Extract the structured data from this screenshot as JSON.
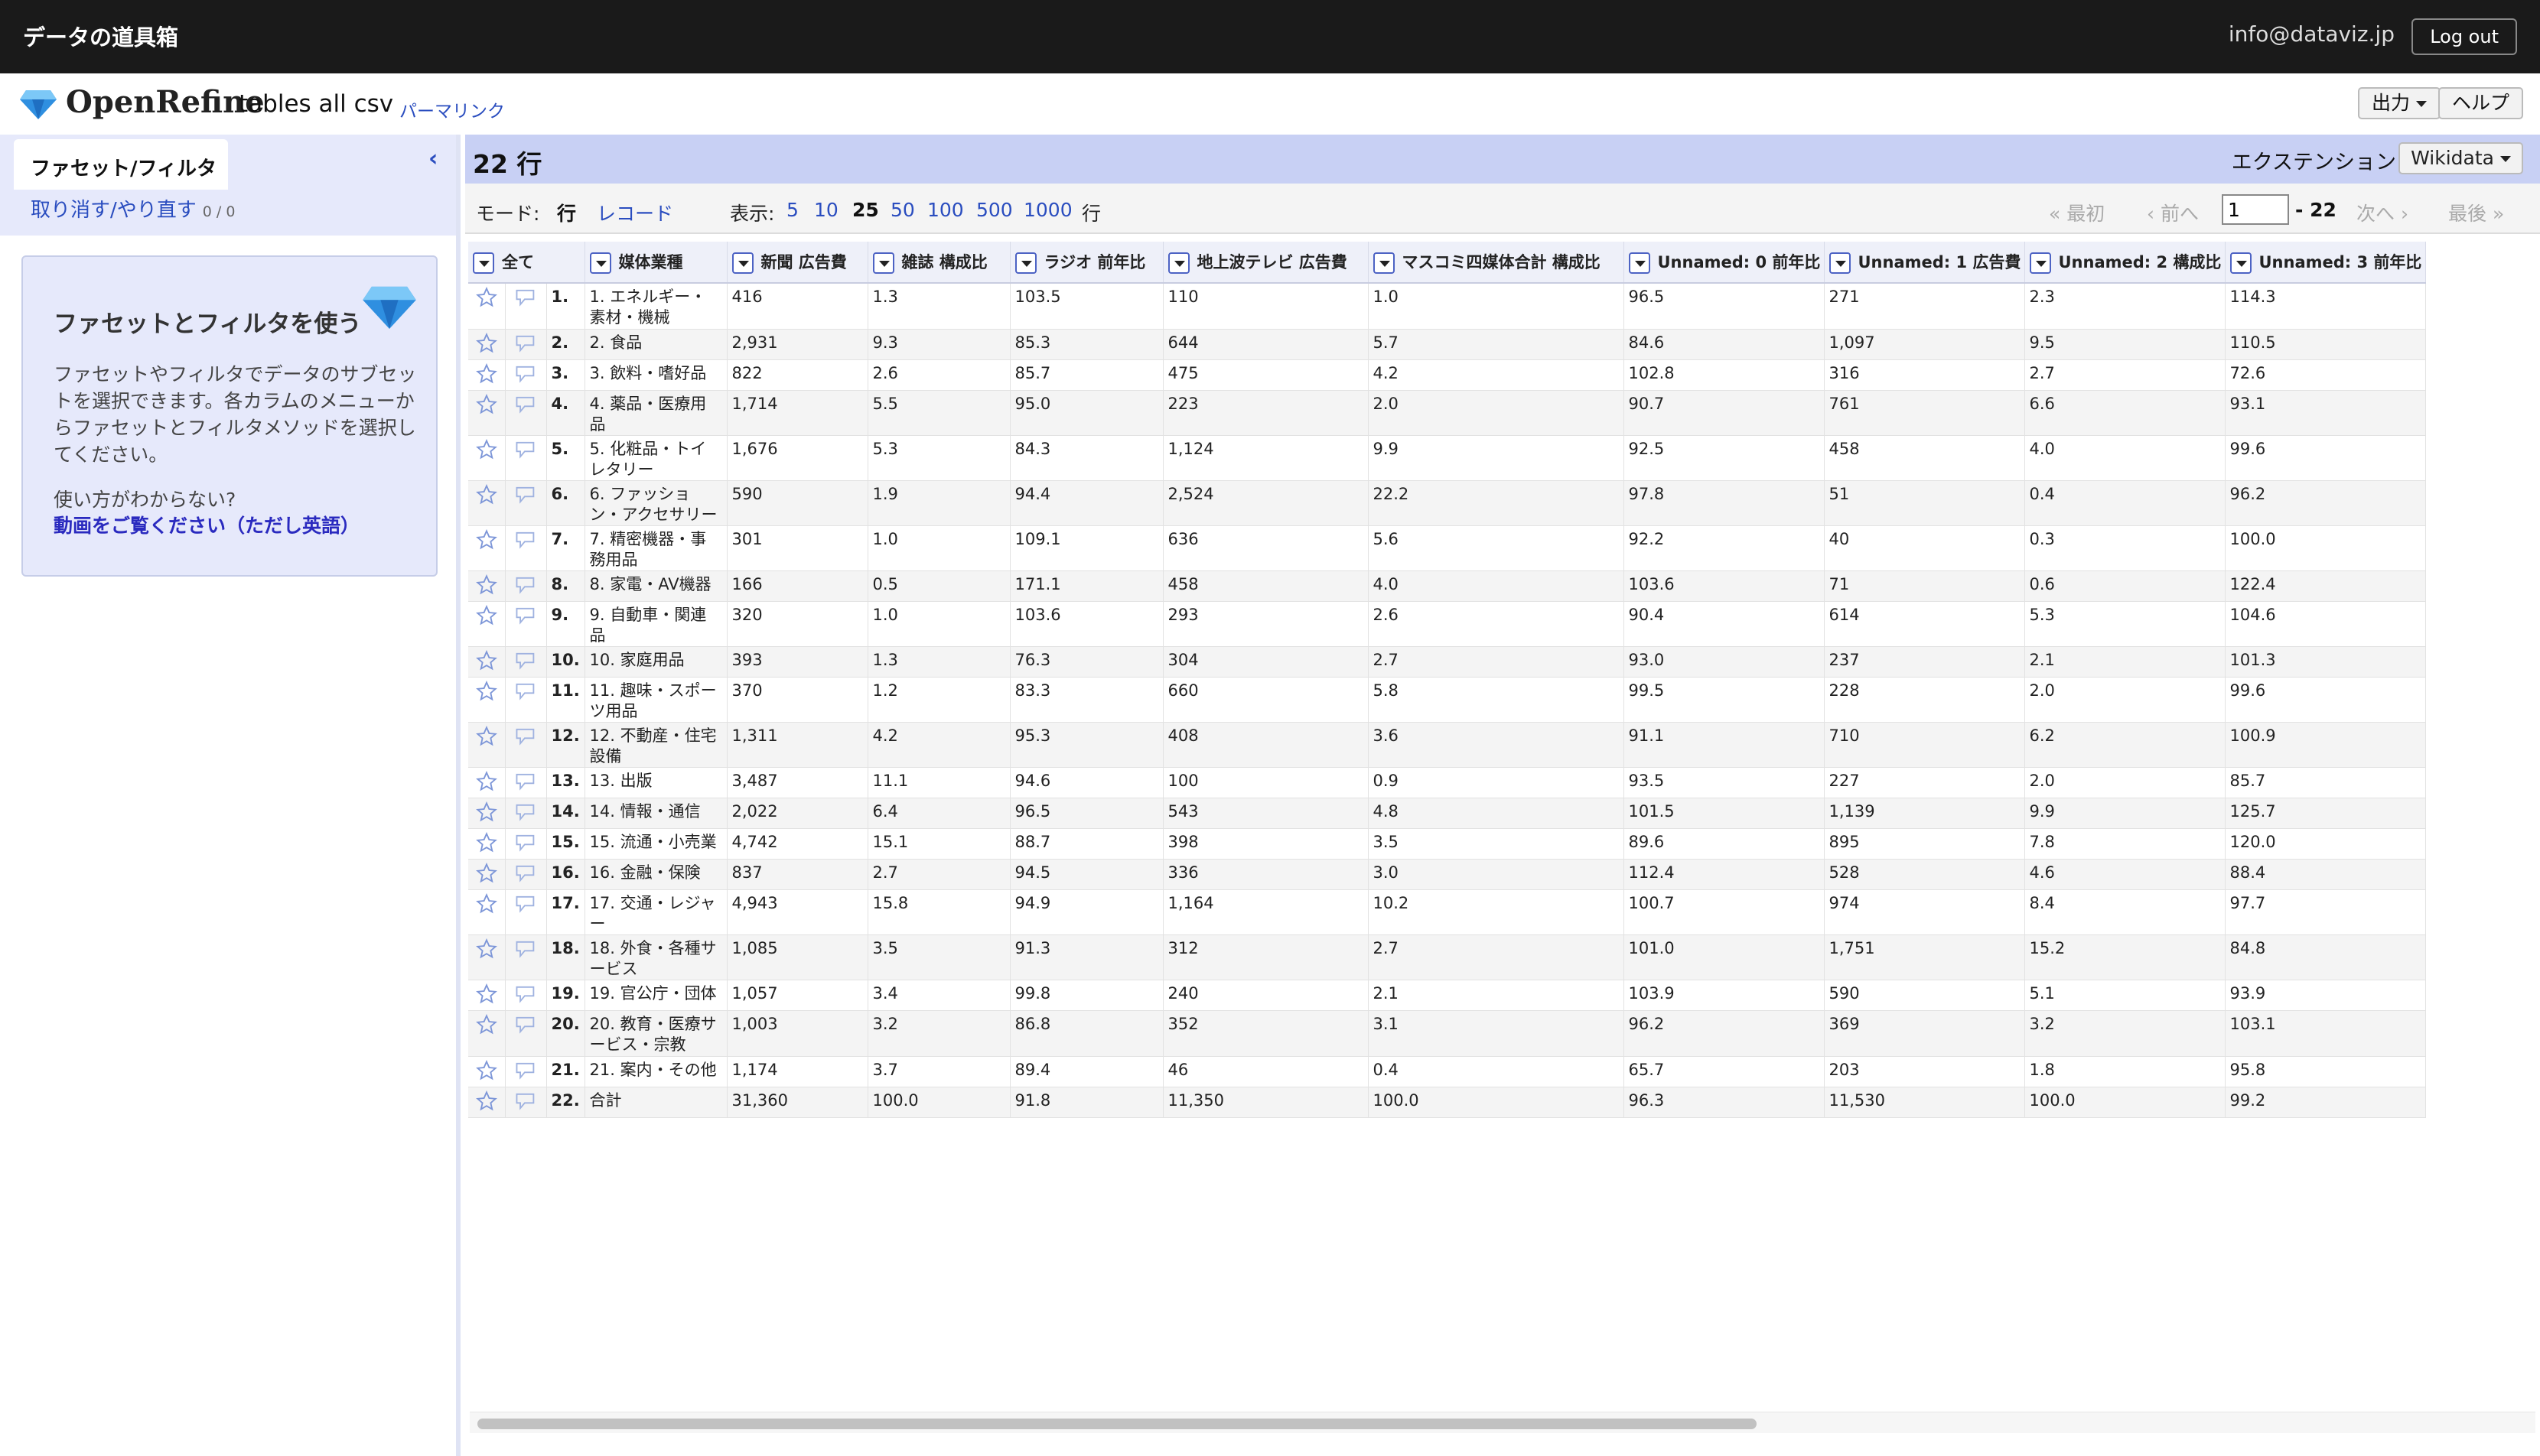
{
  "topbar": {
    "site_title": "データの道具箱",
    "email": "info@dataviz.jp",
    "logout": "Log out"
  },
  "header": {
    "logo": "OpenRefine",
    "project_name": "tables all csv",
    "permalink": "パーマリンク",
    "export": "出力",
    "help": "ヘルプ"
  },
  "left": {
    "tab": "ファセット/フィルタ",
    "undo": "取り消す/やり直す",
    "undo_count": "0 / 0",
    "box_title": "ファセットとフィルタを使う",
    "box_desc": "ファセットやフィルタでデータのサブセットを選択できます。各カラムのメニューからファセットとフィルタメソッドを選択してください。",
    "box_question": "使い方がわからない?",
    "box_video": "動画をご覧ください（ただし英語）"
  },
  "summary": {
    "rows": "22 行",
    "extensions": "エクステンション",
    "wikidata": "Wikidata"
  },
  "controls": {
    "mode_label": "モード:",
    "mode_rows": "行",
    "mode_records": "レコード",
    "show_label": "表示:",
    "sizes": [
      "5",
      "10",
      "25",
      "50",
      "100",
      "500",
      "1000"
    ],
    "selected_size": "25",
    "rows_unit": "行",
    "first": "« 最初",
    "prev": "‹ 前へ",
    "page": "1",
    "total": "- 22",
    "next": "次へ ›",
    "last": "最後 »"
  },
  "colors": {
    "accent": "#2a4dbf",
    "summary_bg": "#c8d0f4",
    "topbar": "#1a1a1a"
  },
  "table": {
    "all_label": "全て",
    "columns": [
      "媒体業種",
      "新聞 広告費",
      "雑誌 構成比",
      "ラジオ 前年比",
      "地上波テレビ 広告費",
      "マスコミ四媒体合計 構成比",
      "Unnamed: 0 前年比",
      "Unnamed: 1 広告費",
      "Unnamed: 2 構成比",
      "Unnamed: 3 前年比"
    ],
    "rows": [
      [
        "1.",
        "1. エネルギー・素材・機械",
        "416",
        "1.3",
        "103.5",
        "110",
        "1.0",
        "96.5",
        "271",
        "2.3",
        "114.3"
      ],
      [
        "2.",
        "2. 食品",
        "2,931",
        "9.3",
        "85.3",
        "644",
        "5.7",
        "84.6",
        "1,097",
        "9.5",
        "110.5"
      ],
      [
        "3.",
        "3. 飲料・嗜好品",
        "822",
        "2.6",
        "85.7",
        "475",
        "4.2",
        "102.8",
        "316",
        "2.7",
        "72.6"
      ],
      [
        "4.",
        "4. 薬品・医療用品",
        "1,714",
        "5.5",
        "95.0",
        "223",
        "2.0",
        "90.7",
        "761",
        "6.6",
        "93.1"
      ],
      [
        "5.",
        "5. 化粧品・トイレタリー",
        "1,676",
        "5.3",
        "84.3",
        "1,124",
        "9.9",
        "92.5",
        "458",
        "4.0",
        "99.6"
      ],
      [
        "6.",
        "6. ファッション・アクセサリー",
        "590",
        "1.9",
        "94.4",
        "2,524",
        "22.2",
        "97.8",
        "51",
        "0.4",
        "96.2"
      ],
      [
        "7.",
        "7. 精密機器・事務用品",
        "301",
        "1.0",
        "109.1",
        "636",
        "5.6",
        "92.2",
        "40",
        "0.3",
        "100.0"
      ],
      [
        "8.",
        "8. 家電・AV機器",
        "166",
        "0.5",
        "171.1",
        "458",
        "4.0",
        "103.6",
        "71",
        "0.6",
        "122.4"
      ],
      [
        "9.",
        "9. 自動車・関連品",
        "320",
        "1.0",
        "103.6",
        "293",
        "2.6",
        "90.4",
        "614",
        "5.3",
        "104.6"
      ],
      [
        "10.",
        "10. 家庭用品",
        "393",
        "1.3",
        "76.3",
        "304",
        "2.7",
        "93.0",
        "237",
        "2.1",
        "101.3"
      ],
      [
        "11.",
        "11. 趣味・スポーツ用品",
        "370",
        "1.2",
        "83.3",
        "660",
        "5.8",
        "99.5",
        "228",
        "2.0",
        "99.6"
      ],
      [
        "12.",
        "12. 不動産・住宅設備",
        "1,311",
        "4.2",
        "95.3",
        "408",
        "3.6",
        "91.1",
        "710",
        "6.2",
        "100.9"
      ],
      [
        "13.",
        "13. 出版",
        "3,487",
        "11.1",
        "94.6",
        "100",
        "0.9",
        "93.5",
        "227",
        "2.0",
        "85.7"
      ],
      [
        "14.",
        "14. 情報・通信",
        "2,022",
        "6.4",
        "96.5",
        "543",
        "4.8",
        "101.5",
        "1,139",
        "9.9",
        "125.7"
      ],
      [
        "15.",
        "15. 流通・小売業",
        "4,742",
        "15.1",
        "88.7",
        "398",
        "3.5",
        "89.6",
        "895",
        "7.8",
        "120.0"
      ],
      [
        "16.",
        "16. 金融・保険",
        "837",
        "2.7",
        "94.5",
        "336",
        "3.0",
        "112.4",
        "528",
        "4.6",
        "88.4"
      ],
      [
        "17.",
        "17. 交通・レジャー",
        "4,943",
        "15.8",
        "94.9",
        "1,164",
        "10.2",
        "100.7",
        "974",
        "8.4",
        "97.7"
      ],
      [
        "18.",
        "18. 外食・各種サービス",
        "1,085",
        "3.5",
        "91.3",
        "312",
        "2.7",
        "101.0",
        "1,751",
        "15.2",
        "84.8"
      ],
      [
        "19.",
        "19. 官公庁・団体",
        "1,057",
        "3.4",
        "99.8",
        "240",
        "2.1",
        "103.9",
        "590",
        "5.1",
        "93.9"
      ],
      [
        "20.",
        "20. 教育・医療サービス・宗教",
        "1,003",
        "3.2",
        "86.8",
        "352",
        "3.1",
        "96.2",
        "369",
        "3.2",
        "103.1"
      ],
      [
        "21.",
        "21. 案内・その他",
        "1,174",
        "3.7",
        "89.4",
        "46",
        "0.4",
        "65.7",
        "203",
        "1.8",
        "95.8"
      ],
      [
        "22.",
        "合計",
        "31,360",
        "100.0",
        "91.8",
        "11,350",
        "100.0",
        "96.3",
        "11,530",
        "100.0",
        "99.2"
      ]
    ]
  }
}
